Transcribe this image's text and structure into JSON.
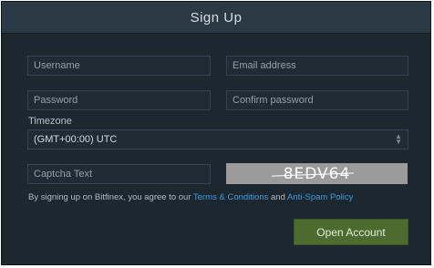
{
  "dialog": {
    "title": "Sign Up"
  },
  "form": {
    "username_placeholder": "Username",
    "email_placeholder": "Email address",
    "password_placeholder": "Password",
    "confirm_password_placeholder": "Confirm password",
    "timezone_label": "Timezone",
    "timezone_value": "(GMT+00:00) UTC",
    "captcha_placeholder": "Captcha Text",
    "captcha_image_text": "8EDV64"
  },
  "terms": {
    "prefix": "By signing up on Bitfinex, you agree to our",
    "terms_link": "Terms & Conditions",
    "and": "and",
    "policy_link": "Anti-Spam Policy"
  },
  "actions": {
    "submit_label": "Open Account"
  },
  "colors": {
    "background": "#1c2730",
    "header": "#2b3945",
    "link": "#3f9ae0",
    "button": "#4d6b2e"
  }
}
